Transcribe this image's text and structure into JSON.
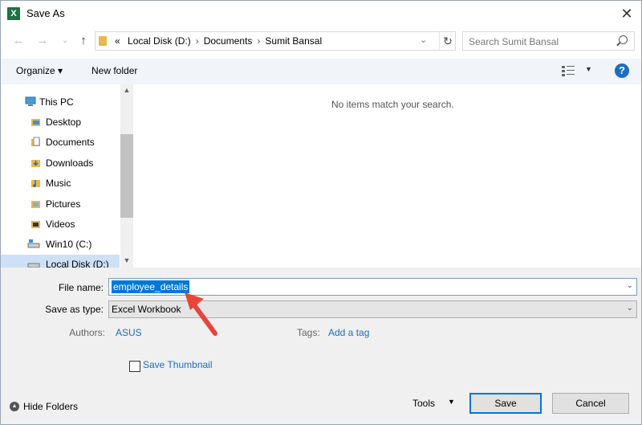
{
  "window": {
    "title": "Save As",
    "app_icon_letter": "X"
  },
  "address": {
    "overflow": "«",
    "crumbs": [
      "Local Disk (D:)",
      "Documents",
      "Sumit Bansal"
    ],
    "separator": "›"
  },
  "search": {
    "placeholder": "Search Sumit Bansal"
  },
  "toolbar": {
    "organize": "Organize ▾",
    "new_folder": "New folder",
    "help": "?"
  },
  "nav": {
    "items": [
      {
        "label": "This PC",
        "icon": "computer-icon"
      },
      {
        "label": "Desktop",
        "icon": "folder-icon"
      },
      {
        "label": "Documents",
        "icon": "documents-icon"
      },
      {
        "label": "Downloads",
        "icon": "downloads-icon"
      },
      {
        "label": "Music",
        "icon": "music-icon"
      },
      {
        "label": "Pictures",
        "icon": "pictures-icon"
      },
      {
        "label": "Videos",
        "icon": "videos-icon"
      },
      {
        "label": "Win10 (C:)",
        "icon": "drive-icon"
      },
      {
        "label": "Local Disk (D:)",
        "icon": "drive-icon",
        "selected": true
      }
    ]
  },
  "content": {
    "empty_message": "No items match your search."
  },
  "form": {
    "filename_label": "File name:",
    "filename_value": "employee_details",
    "savetype_label": "Save as type:",
    "savetype_value": "Excel Workbook",
    "authors_label": "Authors:",
    "authors_value": "ASUS",
    "tags_label": "Tags:",
    "tags_value": "Add a tag",
    "thumbnail_label": "Save Thumbnail"
  },
  "footer": {
    "hide_folders": "Hide Folders",
    "tools": "Tools",
    "save": "Save",
    "cancel": "Cancel"
  },
  "colors": {
    "accent": "#0078d7",
    "link": "#1a6dc1",
    "annotation_arrow": "#e8443a"
  }
}
